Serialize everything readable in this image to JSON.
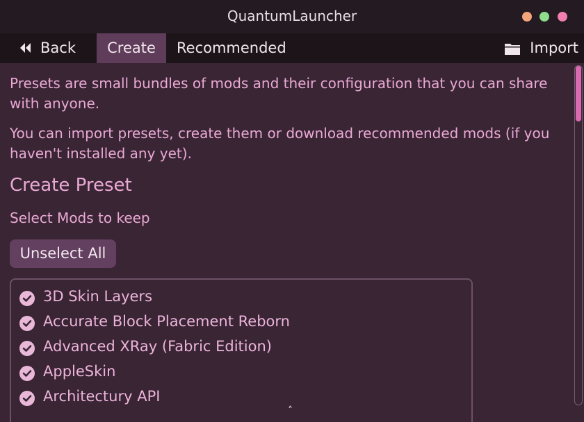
{
  "window": {
    "title": "QuantumLauncher"
  },
  "nav": {
    "back": "Back",
    "create": "Create",
    "recommended": "Recommended",
    "import": "Import"
  },
  "content": {
    "intro1": "Presets are small bundles of mods and their configuration that you can share with anyone.",
    "intro2": "You can import presets, create them or download recommended mods (if you haven't installed any yet).",
    "heading": "Create Preset",
    "subheading": "Select Mods to keep",
    "unselect_all": "Unselect All",
    "mods": [
      {
        "name": "3D Skin Layers",
        "checked": true
      },
      {
        "name": "Accurate Block Placement Reborn",
        "checked": true
      },
      {
        "name": "Advanced XRay (Fabric Edition)",
        "checked": true
      },
      {
        "name": "AppleSkin",
        "checked": true
      },
      {
        "name": "Architectury API",
        "checked": true
      }
    ]
  },
  "scroll_caret": "˄",
  "colors": {
    "background": "#3a2535",
    "accent_pink": "#e9a9d4",
    "active_tab": "#5e3c5a",
    "checkbox": "#e9b8d8"
  }
}
